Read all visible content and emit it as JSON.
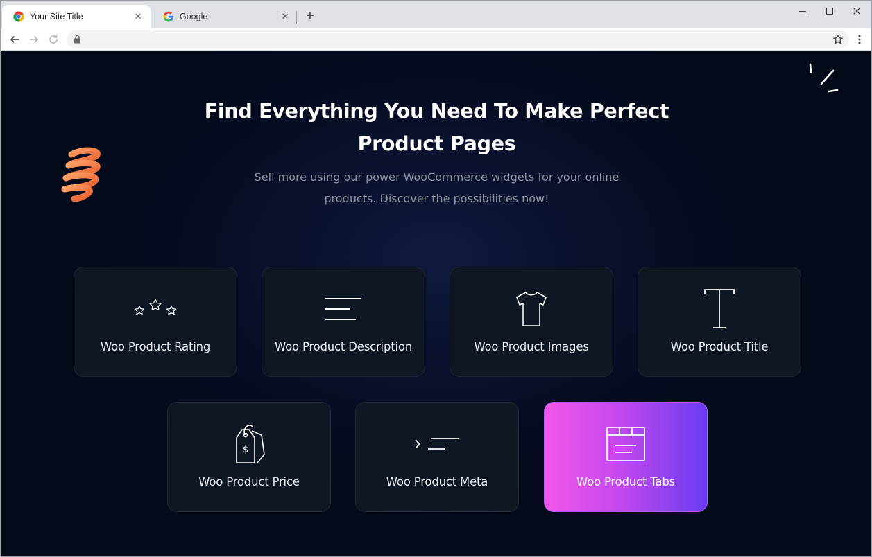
{
  "browser": {
    "tabs": [
      {
        "title": "Your Site Title",
        "active": true
      },
      {
        "title": "Google",
        "active": false
      }
    ],
    "new_tab_symbol": "+",
    "close_symbol": "✕"
  },
  "hero": {
    "headline": "Find Everything You Need To Make Perfect Product Pages",
    "subtext": "Sell more using our power WooCommerce widgets for your online products. Discover the possibilities now!"
  },
  "widgets": [
    {
      "label": "Woo Product Rating",
      "icon": "stars-icon"
    },
    {
      "label": "Woo Product Description",
      "icon": "text-lines-icon"
    },
    {
      "label": "Woo Product Images",
      "icon": "tshirt-icon"
    },
    {
      "label": "Woo Product Title",
      "icon": "text-t-icon"
    },
    {
      "label": "Woo Product Price",
      "icon": "price-tag-icon"
    },
    {
      "label": "Woo Product Meta",
      "icon": "terminal-icon"
    },
    {
      "label": "Woo Product Tabs",
      "icon": "tabs-window-icon",
      "active": true
    }
  ],
  "colors": {
    "page_background": "#050a1b",
    "card_background": "#0f1624",
    "active_gradient_start": "#f158e9",
    "active_gradient_end": "#6a3cf0",
    "deco_orange": "#f47a3f"
  }
}
